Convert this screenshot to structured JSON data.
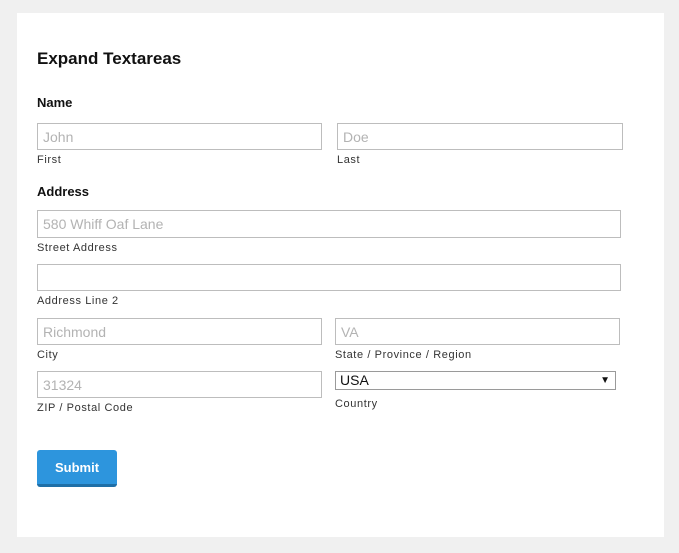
{
  "form": {
    "title": "Expand Textareas",
    "name_section": {
      "label": "Name",
      "first": {
        "placeholder": "John",
        "value": "",
        "sublabel": "First"
      },
      "last": {
        "placeholder": "Doe",
        "value": "",
        "sublabel": "Last"
      }
    },
    "address_section": {
      "label": "Address",
      "street": {
        "placeholder": "580 Whiff Oaf Lane",
        "value": "",
        "sublabel": "Street Address"
      },
      "line2": {
        "placeholder": "",
        "value": "",
        "sublabel": "Address Line 2"
      },
      "city": {
        "placeholder": "Richmond",
        "value": "",
        "sublabel": "City"
      },
      "state": {
        "placeholder": "VA",
        "value": "",
        "sublabel": "State / Province / Region"
      },
      "zip": {
        "placeholder": "31324",
        "value": "",
        "sublabel": "ZIP / Postal Code"
      },
      "country": {
        "selected": "USA",
        "sublabel": "Country",
        "caret": "▼"
      }
    },
    "submit_label": "Submit"
  },
  "colors": {
    "page_bg": "#f0f0f0",
    "card_bg": "#ffffff",
    "button": "#2d95dd",
    "button_shadow": "#1f6fa7",
    "field_border": "#bdbdbd",
    "placeholder": "#b3b3b3"
  },
  "icons": {
    "country_caret": "chevron-down-icon"
  }
}
